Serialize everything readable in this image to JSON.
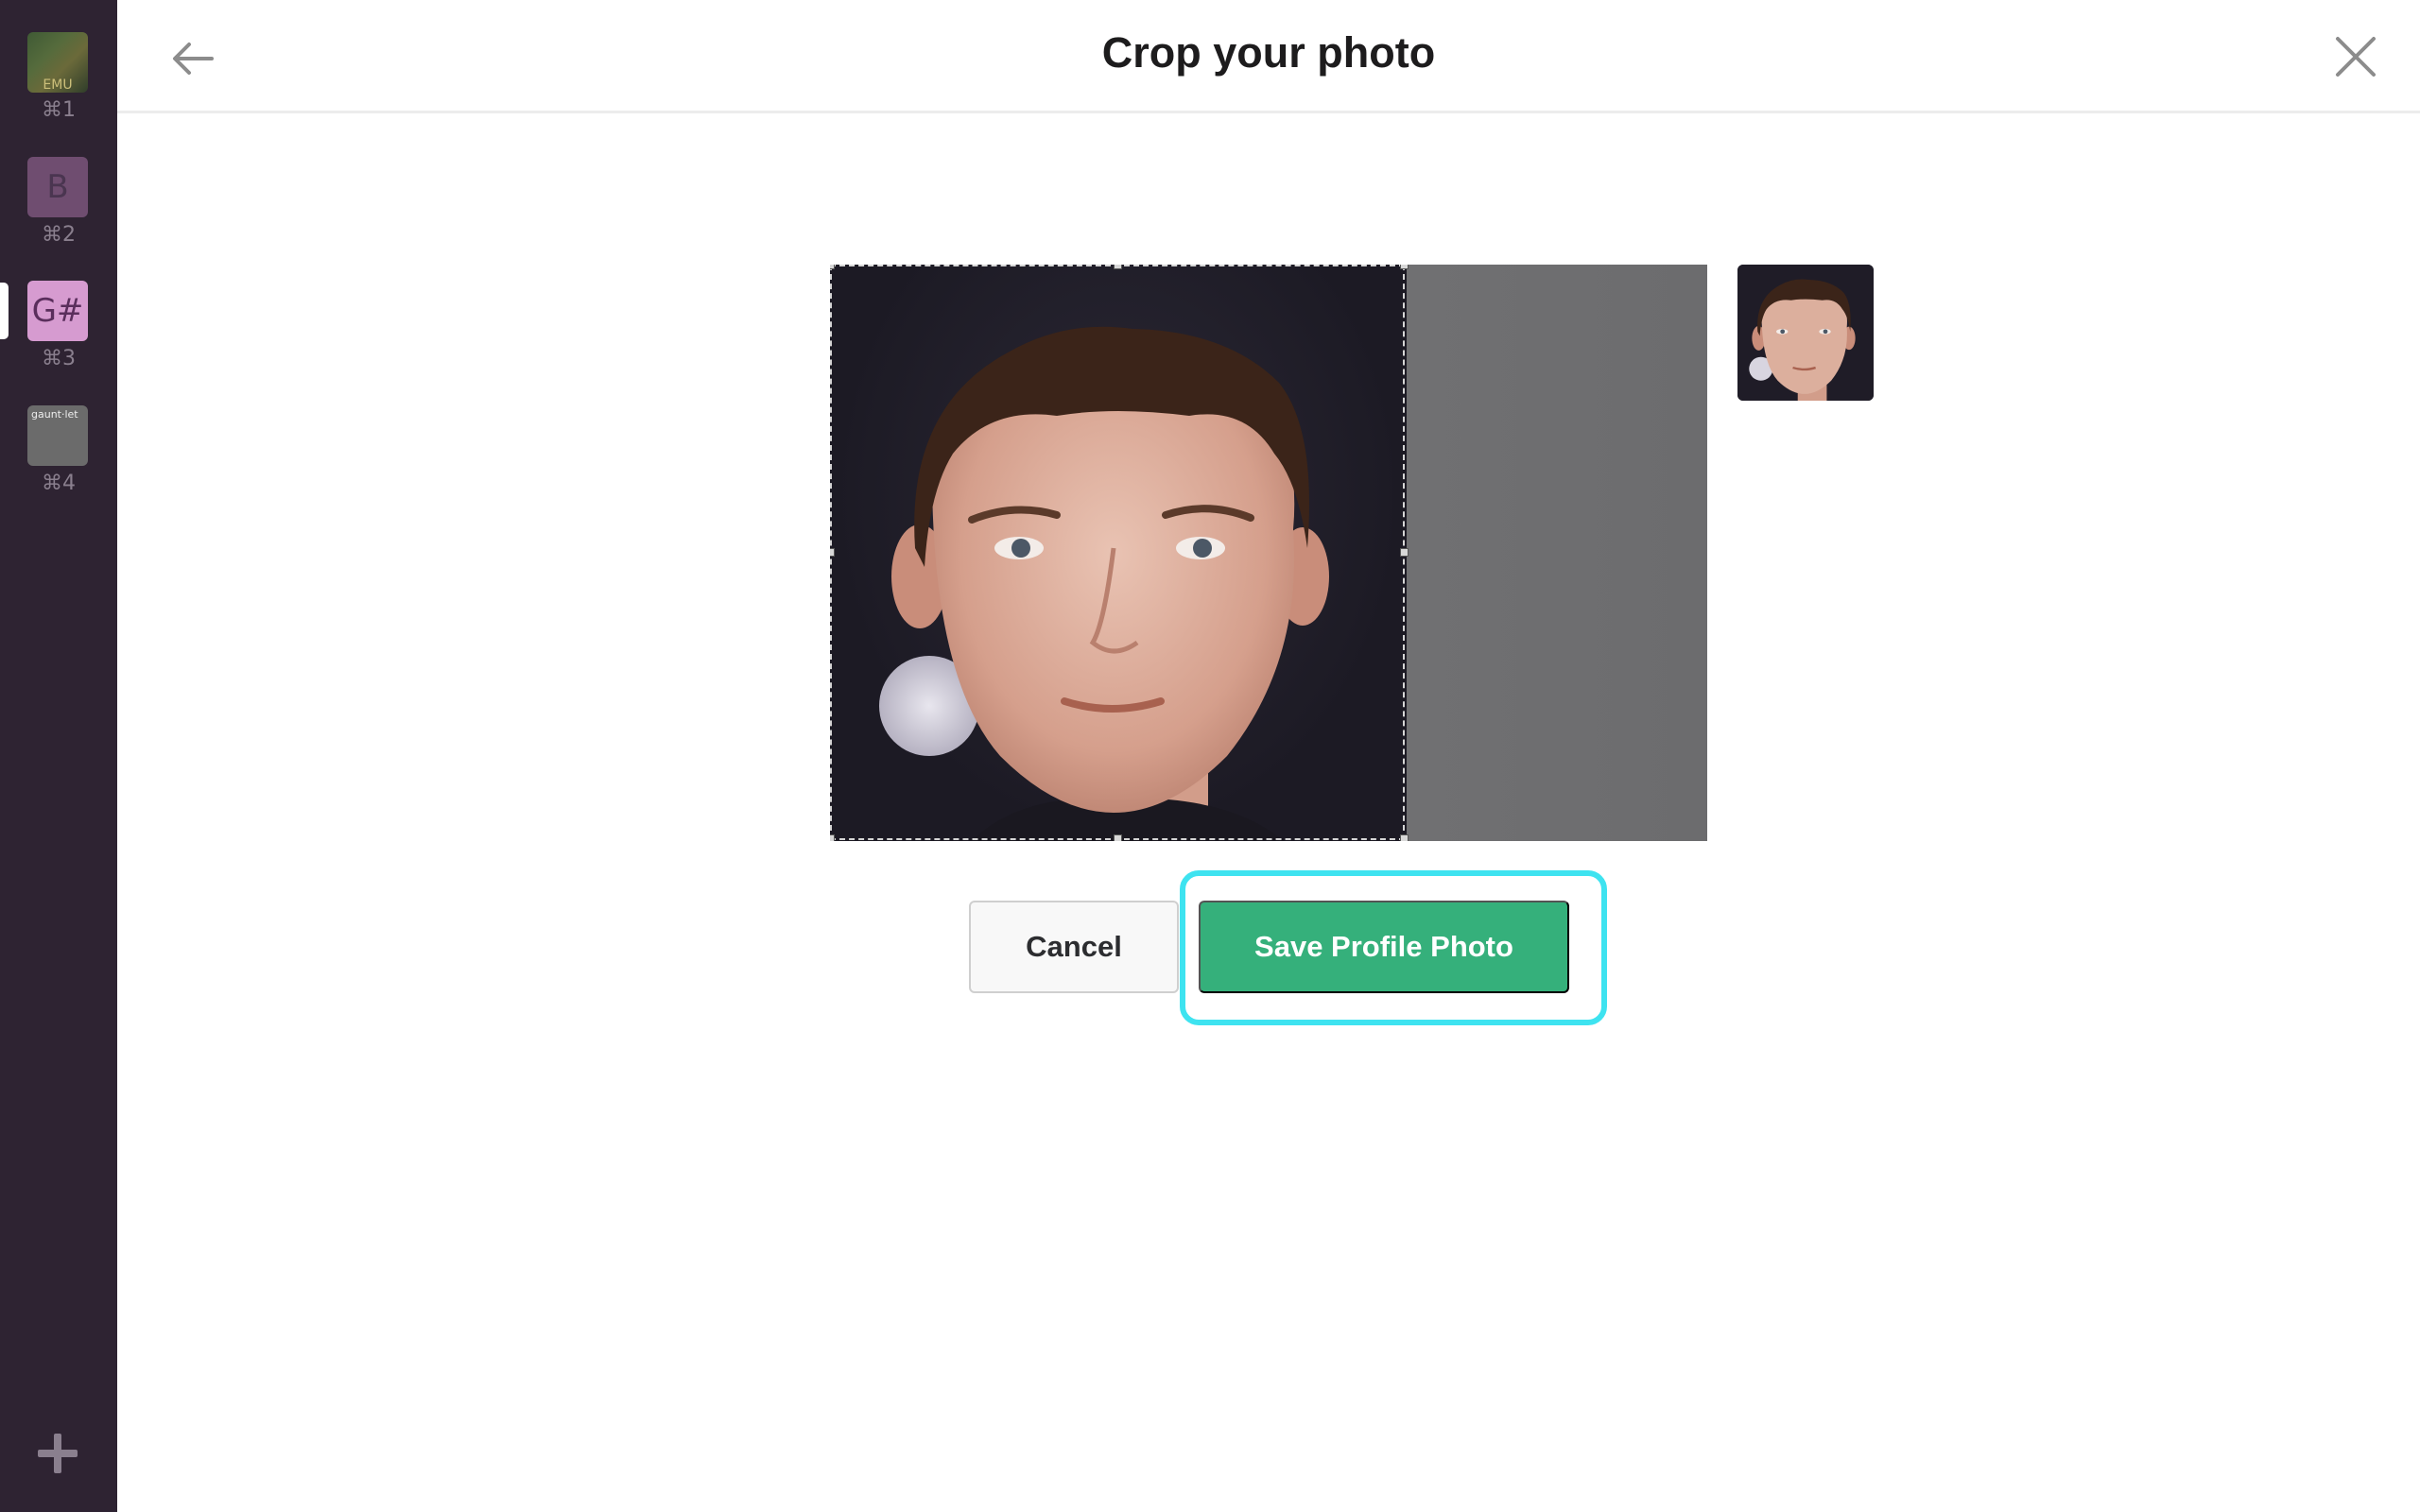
{
  "sidebar": {
    "workspaces": [
      {
        "letter": "",
        "tile_text": "EMU",
        "shortcut": "⌘1"
      },
      {
        "letter": "B",
        "shortcut": "⌘2"
      },
      {
        "letter": "G#",
        "shortcut": "⌘3"
      },
      {
        "letter": "",
        "tile_text": "gaunt·let",
        "shortcut": "⌘4"
      }
    ],
    "active_index": 2,
    "add_icon": "plus-icon"
  },
  "header": {
    "title": "Crop your photo",
    "back_icon": "arrow-left-icon",
    "close_icon": "close-icon"
  },
  "actions": {
    "cancel_label": "Cancel",
    "save_label": "Save Profile Photo"
  },
  "colors": {
    "sidebar_bg": "#2e2332",
    "save_button": "#35b07b",
    "focus_ring": "#3ee3f0"
  }
}
